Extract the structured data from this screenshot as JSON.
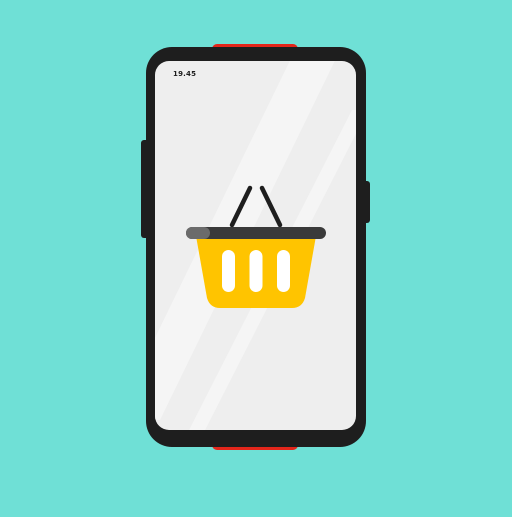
{
  "status_bar": {
    "time": "19.45"
  },
  "illustration": {
    "subject": "shopping-basket-on-phone",
    "icons": [
      "phone-icon",
      "shopping-basket-icon"
    ]
  },
  "colors": {
    "background": "#6fe0d6",
    "phone_body": "#1e1e1e",
    "screen": "#eeeeee",
    "accent_red": "#e3261b",
    "basket_yellow": "#ffc400",
    "basket_handle": "#1e1e1e"
  }
}
